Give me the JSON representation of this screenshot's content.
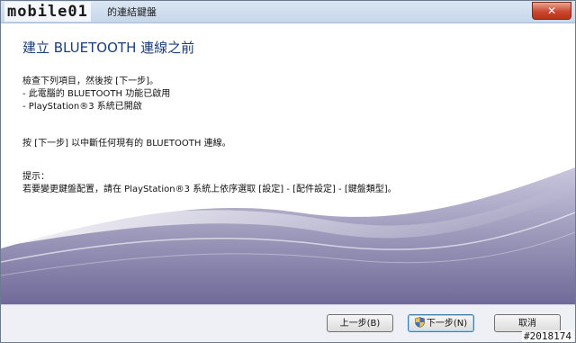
{
  "app": {
    "logo_text": "mobile01",
    "window_title": "的連結鍵盤",
    "close_label": "✕"
  },
  "wizard": {
    "heading": "建立 BLUETOOTH 連線之前",
    "intro": "檢查下列項目，然後按 [下一步]。",
    "items": [
      "- 此電腦的 BLUETOOTH 功能已啟用",
      "- PlayStation®3 系統已開啟"
    ],
    "instruction": "按 [下一步] 以中斷任何現有的 BLUETOOTH 連線。",
    "tip_label": "提示：",
    "tip_text": "若要變更鍵盤配置，請在 PlayStation®3 系統上依序選取 [設定] - [配件設定] - [鍵盤類型]。"
  },
  "buttons": {
    "back": "上一步(B)",
    "next": "下一步(N)",
    "cancel": "取消"
  },
  "watermark": "#2018174",
  "colors": {
    "heading": "#1c3d7a",
    "swoosh": "#7f7aa8"
  },
  "icons": {
    "next_button": "uac-shield-icon"
  }
}
